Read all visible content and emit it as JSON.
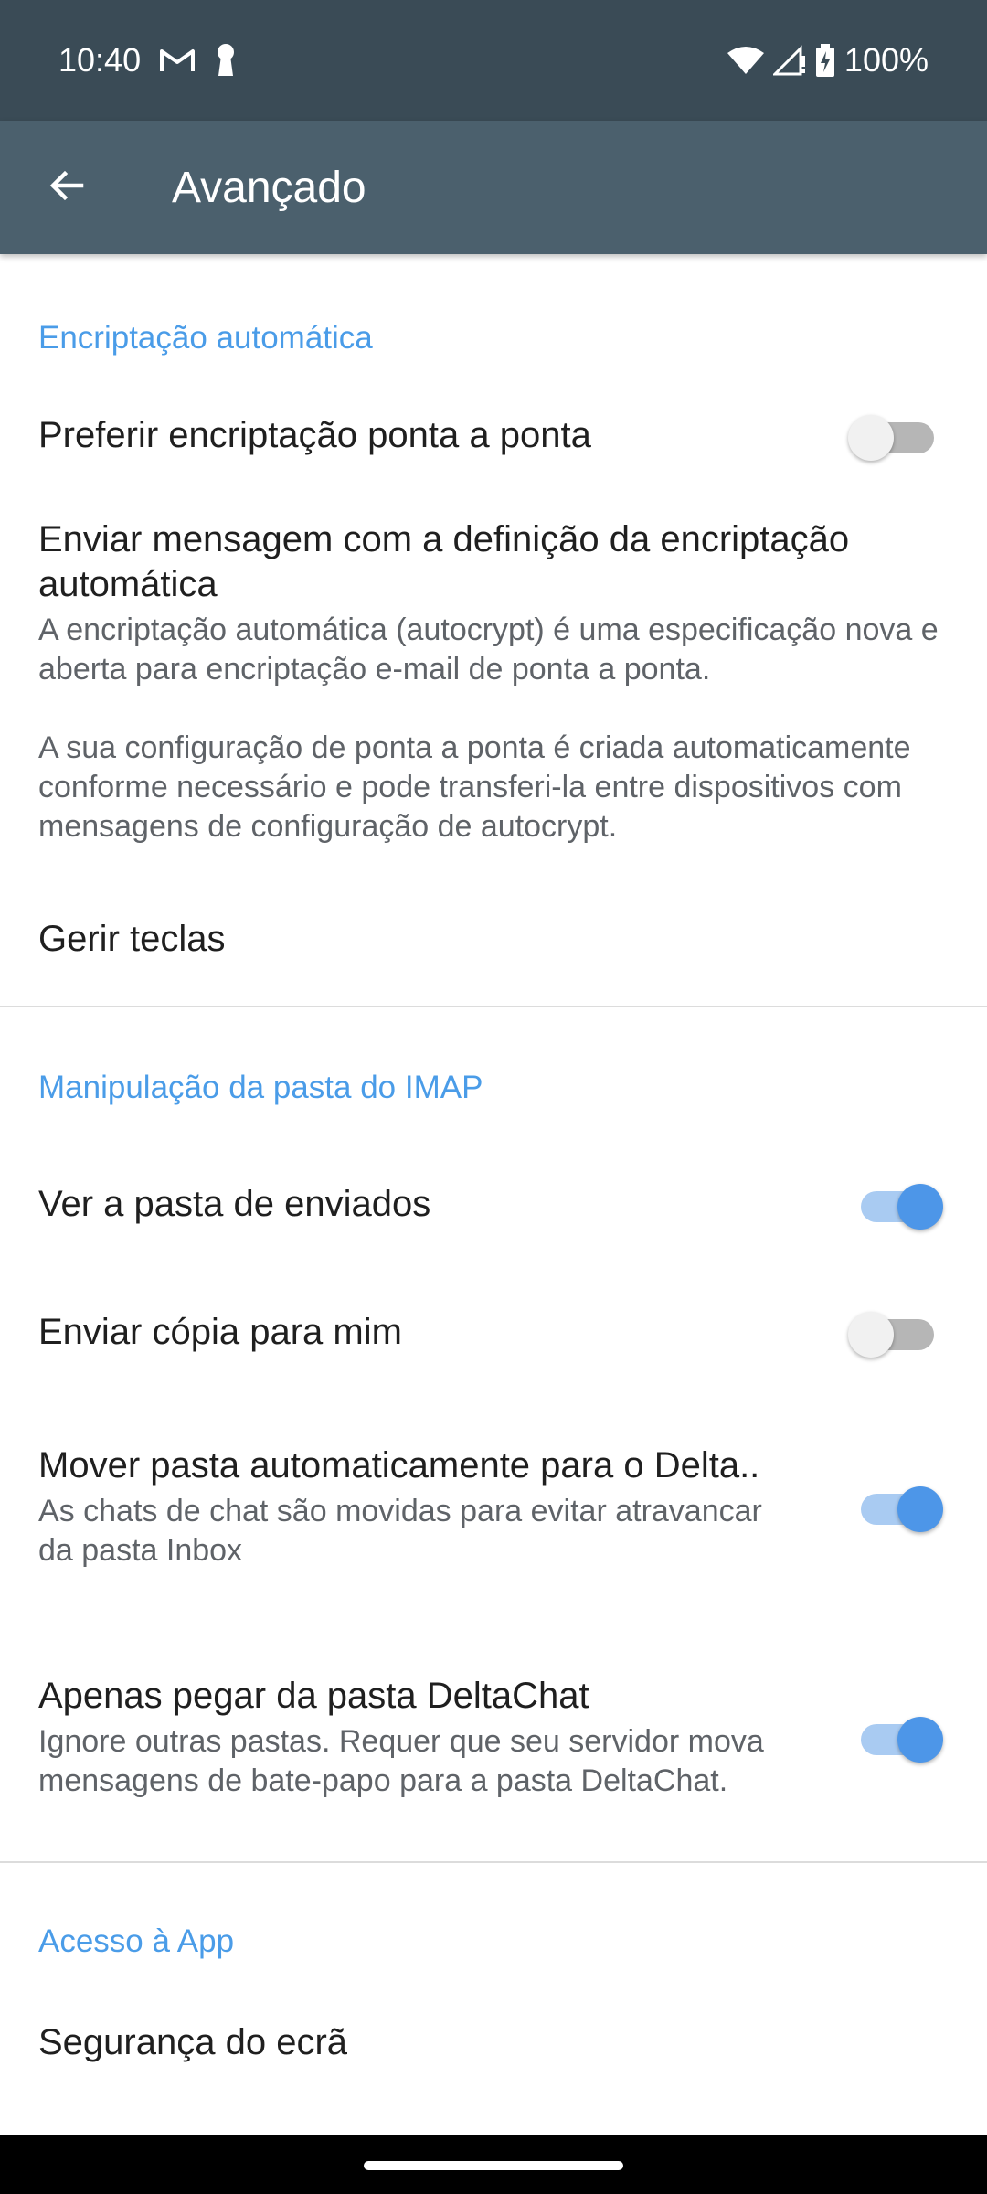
{
  "status_bar": {
    "time": "10:40",
    "battery": "100%",
    "icons": [
      "gmail-icon",
      "keyhole-icon",
      "wifi-icon",
      "signal-icon",
      "battery-charging-icon"
    ]
  },
  "app_bar": {
    "title": "Avançado",
    "back_icon": "arrow-back-icon"
  },
  "sections": {
    "autocrypt": {
      "header": "Encriptação automática",
      "prefer_e2e": {
        "title": "Preferir encriptação ponta a ponta",
        "enabled": false
      },
      "send_setup": {
        "title": "Enviar mensagem com a definição da encriptação automática",
        "summary": "A encriptação automática (autocrypt) é uma especificação nova e aberta para encriptação e-mail de ponta a ponta.\n\n A sua configuração de ponta a ponta é criada automaticamente conforme necessário e pode transferi-la entre dispositivos com mensagens de configuração de autocrypt."
      },
      "manage_keys": {
        "title": "Gerir teclas"
      }
    },
    "imap": {
      "header": "Manipulação da pasta do IMAP",
      "watch_sent": {
        "title": "Ver a pasta de enviados",
        "enabled": true
      },
      "send_copy": {
        "title": "Enviar cópia para mim",
        "enabled": false
      },
      "move_auto": {
        "title": "Mover pasta automaticamente para o Delta..",
        "summary": "As chats de chat são movidas para evitar atravancar da pasta Inbox",
        "enabled": true
      },
      "only_deltachat": {
        "title": "Apenas pegar da pasta DeltaChat",
        "summary": "Ignore outras pastas. Requer que seu servidor mova mensagens de bate-papo para a pasta DeltaChat.",
        "enabled": true
      }
    },
    "app_access": {
      "header": "Acesso à App",
      "screen_security": {
        "title": "Segurança do ecrã"
      }
    }
  },
  "colors": {
    "status_bar": "#3a4b56",
    "app_bar": "#4b606d",
    "accent": "#4a9ce8",
    "switch_on_thumb": "#4d96e8",
    "switch_on_track": "#a9cbf2"
  }
}
